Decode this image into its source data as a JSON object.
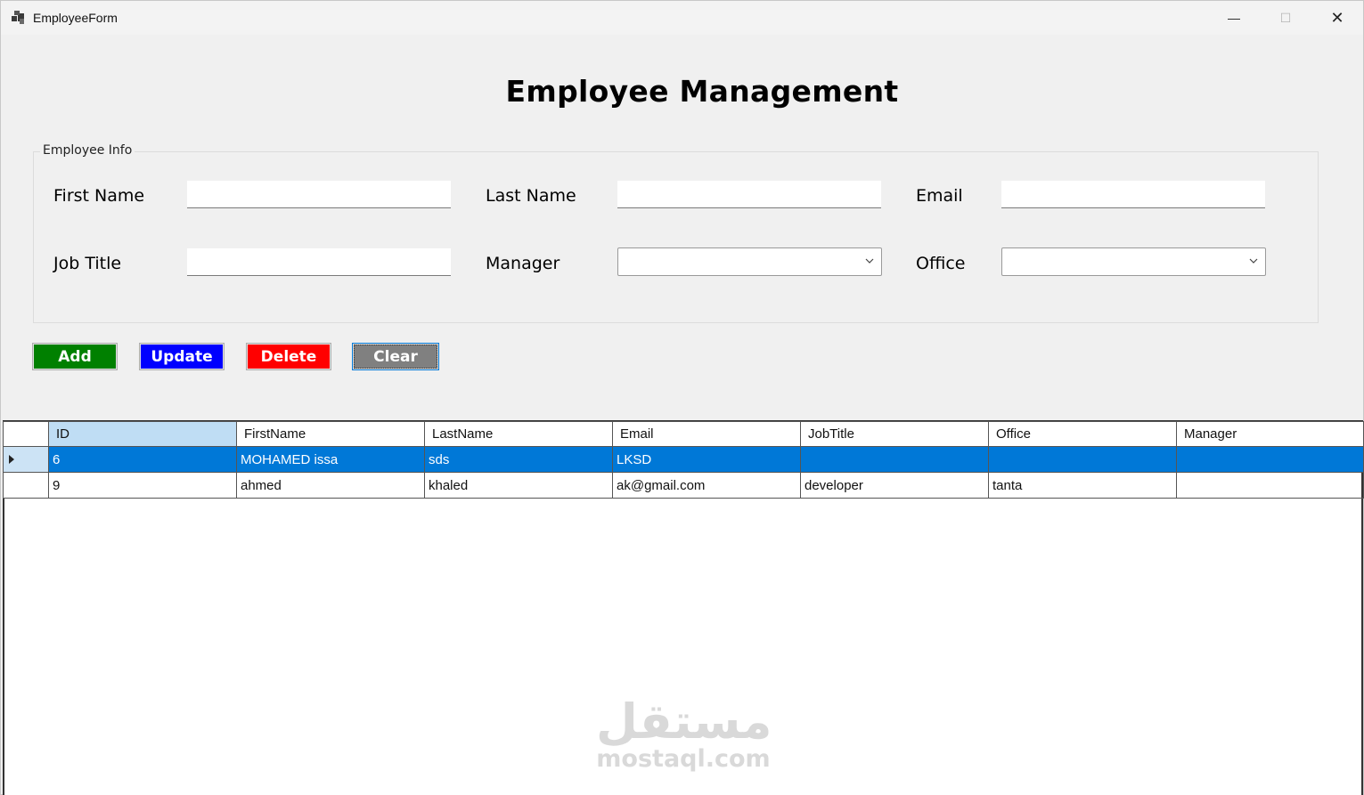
{
  "window": {
    "title": "EmployeeForm",
    "min_glyph": "—",
    "max_glyph": "☐",
    "close_glyph": "✕"
  },
  "heading": "Employee Management",
  "group": {
    "legend": "Employee Info",
    "first_name_label": "First Name",
    "first_name_value": "",
    "last_name_label": "Last Name",
    "last_name_value": "",
    "email_label": "Email",
    "email_value": "",
    "job_title_label": "Job Title",
    "job_title_value": "",
    "manager_label": "Manager",
    "manager_value": "",
    "office_label": "Office",
    "office_value": ""
  },
  "buttons": {
    "add": "Add",
    "update": "Update",
    "delete": "Delete",
    "clear": "Clear",
    "add_color": "#008000",
    "update_color": "#0000ff",
    "delete_color": "#ff0000",
    "clear_color": "#808080"
  },
  "grid": {
    "columns": [
      "ID",
      "FirstName",
      "LastName",
      "Email",
      "JobTitle",
      "Office",
      "Manager"
    ],
    "rows": [
      {
        "ID": "6",
        "FirstName": "MOHAMED issa",
        "LastName": "sds",
        "Email": "LKSD",
        "JobTitle": "",
        "Office": "",
        "Manager": "",
        "selected": true
      },
      {
        "ID": "9",
        "FirstName": "ahmed",
        "LastName": "khaled",
        "Email": "ak@gmail.com",
        "JobTitle": "developer",
        "Office": "tanta",
        "Manager": "",
        "selected": false
      }
    ],
    "selection_color": "#0078d7"
  },
  "watermark": {
    "logo": "مستقل",
    "text": "mostaql.com"
  }
}
